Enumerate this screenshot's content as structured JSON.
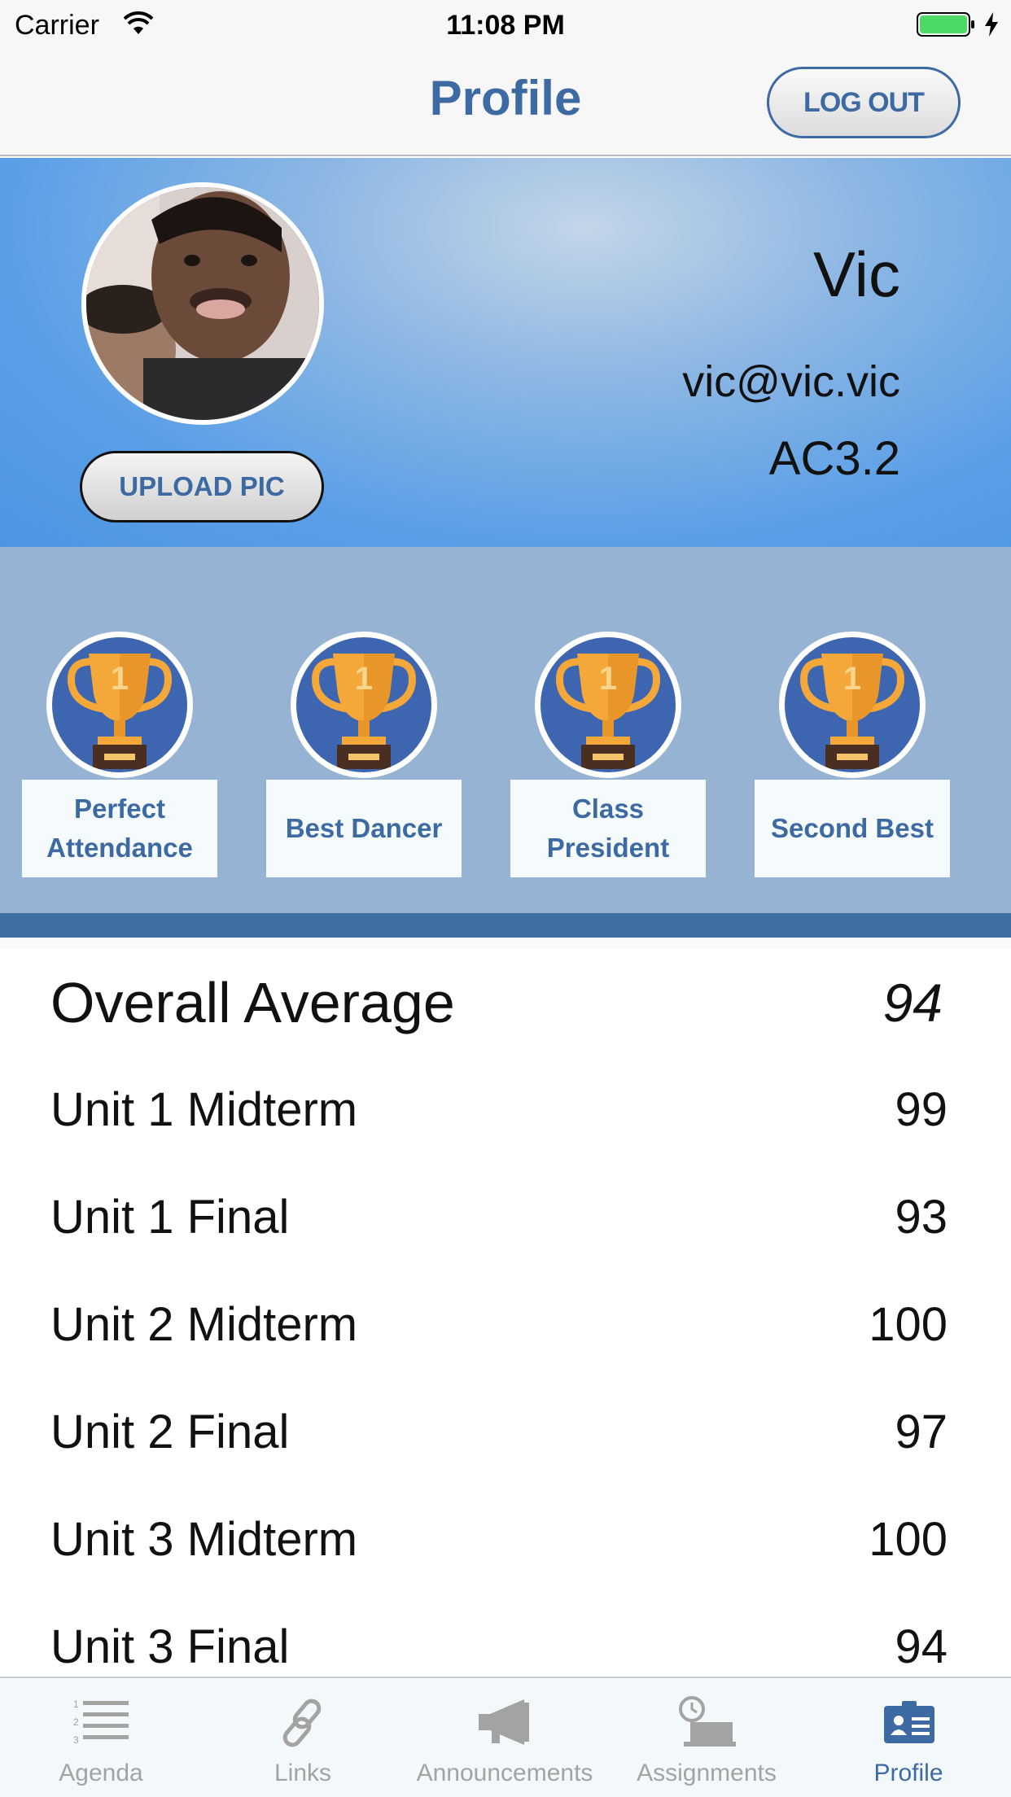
{
  "status_bar": {
    "carrier": "Carrier",
    "time": "11:08 PM",
    "battery_color": "#4cd964"
  },
  "nav": {
    "title": "Profile",
    "logout_label": "LOG OUT"
  },
  "profile": {
    "name": "Vic",
    "email": "vic@vic.vic",
    "class_code": "AC3.2",
    "upload_label": "UPLOAD PIC"
  },
  "badges": [
    {
      "label": "Perfect Attendance",
      "icon": "trophy-icon",
      "rank": "1"
    },
    {
      "label": "Best Dancer",
      "icon": "trophy-icon",
      "rank": "1"
    },
    {
      "label": "Class President",
      "icon": "trophy-icon",
      "rank": "1"
    },
    {
      "label": "Second Best",
      "icon": "trophy-icon",
      "rank": "1"
    }
  ],
  "grades": {
    "overall": {
      "label": "Overall Average",
      "value": "94"
    },
    "items": [
      {
        "label": "Unit 1 Midterm",
        "value": "99"
      },
      {
        "label": "Unit 1 Final",
        "value": "93"
      },
      {
        "label": "Unit 2 Midterm",
        "value": "100"
      },
      {
        "label": "Unit 2 Final",
        "value": "97"
      },
      {
        "label": "Unit 3 Midterm",
        "value": "100"
      },
      {
        "label": "Unit 3 Final",
        "value": "94"
      }
    ]
  },
  "tabs": [
    {
      "label": "Agenda",
      "icon": "list-icon",
      "active": false
    },
    {
      "label": "Links",
      "icon": "link-icon",
      "active": false
    },
    {
      "label": "Announcements",
      "icon": "megaphone-icon",
      "active": false
    },
    {
      "label": "Assignments",
      "icon": "clock-desk-icon",
      "active": false
    },
    {
      "label": "Profile",
      "icon": "id-card-icon",
      "active": true
    }
  ],
  "colors": {
    "accent": "#3e6aa3",
    "header_blue": "#5a9fe6",
    "badge_strip": "#96b3d3",
    "trophy_gold": "#f5a83a"
  }
}
